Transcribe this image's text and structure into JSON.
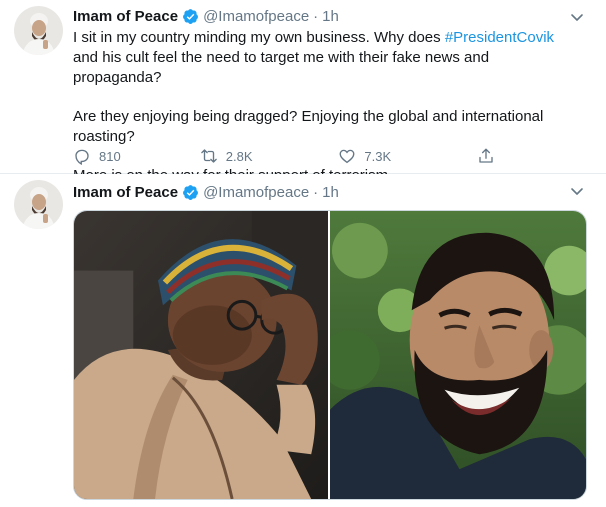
{
  "tweets": [
    {
      "author": {
        "name": "Imam of Peace",
        "handle": "@Imamofpeace",
        "verified": true
      },
      "time": "1h",
      "text": {
        "line1_before": "I sit in my country minding my own business. Why does ",
        "hashtag": "#PresidentCovik",
        "line1_after": " and his cult feel the need to target me with their fake news and propaganda?",
        "para2": "Are they enjoying being dragged? Enjoying the global and international roasting?",
        "para3": "More is on the way for their support of terrorism."
      },
      "stats": {
        "replies": "810",
        "retweets": "2.8K",
        "likes": "7.3K"
      }
    },
    {
      "author": {
        "name": "Imam of Peace",
        "handle": "@Imamofpeace",
        "verified": true
      },
      "time": "1h",
      "media": [
        "photo-man-in-kufi-cap",
        "photo-bearded-man-laughing"
      ]
    }
  ],
  "icons": {
    "reply": "reply-icon",
    "retweet": "retweet-icon",
    "like": "heart-icon",
    "share": "share-icon",
    "more": "chevron-down-icon",
    "verified": "verified-badge-icon"
  },
  "colors": {
    "link": "#1b95e0",
    "secondary_text": "#657786",
    "verified_badge": "#1da1f2",
    "divider": "#e6ecf0"
  }
}
